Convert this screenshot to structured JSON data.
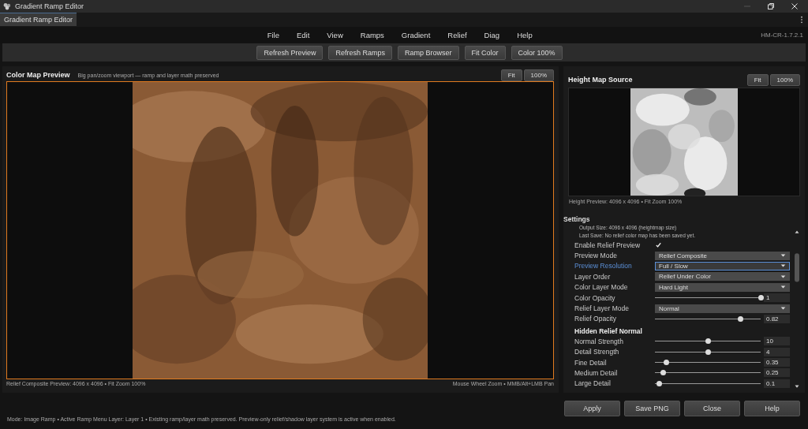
{
  "window": {
    "title": "Gradient Ramp Editor"
  },
  "doc_tabs": [
    {
      "label": "Gradient Ramp Editor",
      "selected": true
    }
  ],
  "menu": [
    "File",
    "Edit",
    "View",
    "Ramps",
    "Gradient",
    "Relief",
    "Diag",
    "Help"
  ],
  "version": "HM-CR-1.7.2.1",
  "toolbar": [
    "Refresh Preview",
    "Refresh Ramps",
    "Ramp Browser",
    "Fit Color",
    "Color 100%"
  ],
  "color_preview": {
    "title": "Color Map Preview",
    "subtitle": "Big pan/zoom viewport — ramp and layer math preserved",
    "buttons": [
      "Fit",
      "100%"
    ],
    "caption_left": "Relief Composite Preview: 4096 x 4096  •  Fit Zoom 100%",
    "caption_right": "Mouse Wheel Zoom  •  MMB/Alt+LMB Pan"
  },
  "height_map": {
    "title": "Height Map Source",
    "buttons": [
      "Fit",
      "100%"
    ],
    "caption": "Height Preview: 4096 x 4096  •  Fit Zoom 100%"
  },
  "settings": {
    "title": "Settings",
    "info": [
      "Output Size: 4096 x 4096 (heightmap size)",
      "Last Save: No relief color map has been saved yet."
    ],
    "rows": [
      {
        "kind": "checkbox",
        "label": "Enable Relief Preview",
        "checked": true
      },
      {
        "kind": "select",
        "label": "Preview Mode",
        "value": "Relief Composite"
      },
      {
        "kind": "select",
        "label": "Preview Resolution",
        "value": "Full / Slow",
        "focused": true
      },
      {
        "kind": "select",
        "label": "Layer Order",
        "value": "Relief Under Color"
      },
      {
        "kind": "select",
        "label": "Color Layer Mode",
        "value": "Hard Light"
      },
      {
        "kind": "slider",
        "label": "Color Opacity",
        "level": 1,
        "value": "1"
      },
      {
        "kind": "select",
        "label": "Relief Layer Mode",
        "value": "Normal"
      },
      {
        "kind": "slider",
        "label": "Relief Opacity",
        "level": 0.81,
        "value": "0.82"
      },
      {
        "kind": "heading",
        "label": "Hidden Relief Normal"
      },
      {
        "kind": "slider",
        "label": "Normal Strength",
        "level": 0.5,
        "value": "10"
      },
      {
        "kind": "slider",
        "label": "Detail Strength",
        "level": 0.5,
        "value": "4"
      },
      {
        "kind": "slider",
        "label": "Fine Detail",
        "level": 0.11,
        "value": "0.35"
      },
      {
        "kind": "slider",
        "label": "Medium Detail",
        "level": 0.08,
        "value": "0.25"
      },
      {
        "kind": "slider",
        "label": "Large Detail",
        "level": 0.04,
        "value": "0.1"
      }
    ]
  },
  "status_bar": "Mode: Image Ramp  •  Active Ramp Menu Layer: Layer 1  •  Existing ramp/layer math preserved. Preview-only relief/shadow layer system is active when enabled.",
  "dialog_buttons": [
    "Apply",
    "Save PNG",
    "Close",
    "Help"
  ]
}
